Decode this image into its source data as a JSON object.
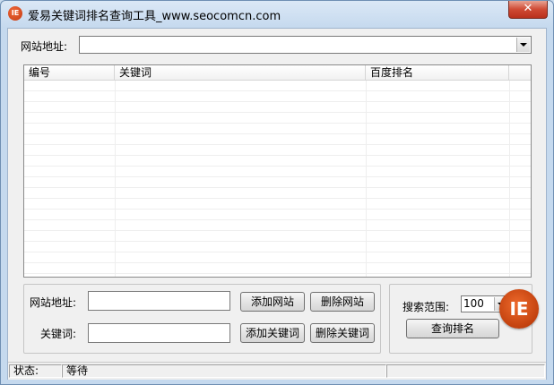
{
  "window": {
    "title": "爱易关键词排名查询工具_www.seocomcn.com",
    "app_icon_text": "IE",
    "close_glyph": "✕"
  },
  "top": {
    "site_label": "网站地址:",
    "site_value": ""
  },
  "list": {
    "columns": [
      "编号",
      "关键词",
      "百度排名"
    ],
    "rows": []
  },
  "form": {
    "site_label": "网站地址:",
    "site_value": "",
    "keyword_label": "关键词:",
    "keyword_value": "",
    "add_site": "添加网站",
    "delete_site": "删除网站",
    "add_keyword": "添加关键词",
    "delete_keyword": "删除关键词"
  },
  "search": {
    "range_label": "搜索范围:",
    "range_value": "100",
    "query_button": "查询排名"
  },
  "logo": {
    "text": "IE"
  },
  "status": {
    "label": "状态:",
    "value": "等待",
    "extra": ""
  },
  "colors": {
    "accent": "#c43a12",
    "title_bar": "#c5d9ee"
  }
}
